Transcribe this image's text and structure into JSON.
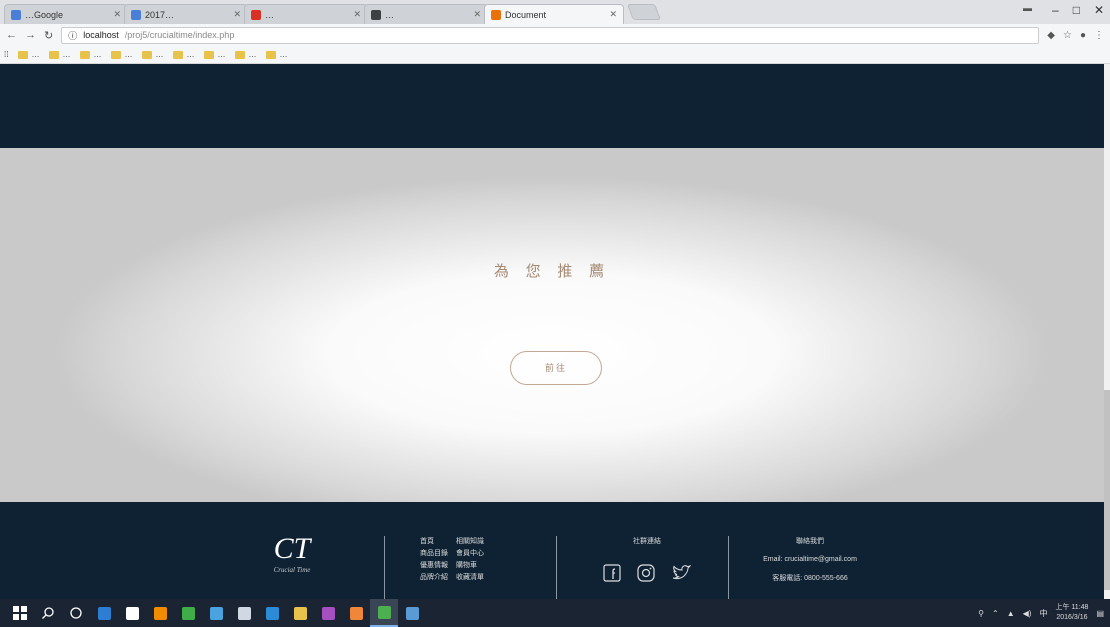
{
  "browser": {
    "tabs": [
      {
        "label": "…Google",
        "color": "#4a7fd8",
        "active": false
      },
      {
        "label": "2017…",
        "color": "#4a7fd8",
        "active": false
      },
      {
        "label": "…",
        "color": "#d93025",
        "active": false
      },
      {
        "label": "…",
        "color": "#3c4043",
        "active": false
      },
      {
        "label": "Document",
        "color": "#e8710a",
        "active": true
      }
    ],
    "address": {
      "host": "localhost",
      "path": "/proj5/crucialtime/index.php"
    },
    "bookmarks": [
      "…",
      "…",
      "…",
      "…",
      "…",
      "…",
      "…",
      "…",
      "…"
    ]
  },
  "page": {
    "recommend": {
      "title": "為 您 推 薦",
      "button": "前往"
    },
    "footer": {
      "logo_mark": "CT",
      "logo_sub": "Crucial Time",
      "links": [
        "首頁",
        "相關知識",
        "商品目錄",
        "會員中心",
        "優惠情報",
        "購物車",
        "品牌介紹",
        "收藏清單"
      ],
      "social_title": "社群連結",
      "contact_title": "聯絡我們",
      "email": "Email: crucialtime@gmail.com",
      "phone": "客服電話: 0800-555-666"
    }
  },
  "taskbar": {
    "apps": [
      {
        "name": "edge",
        "color": "#2d7dd2"
      },
      {
        "name": "store",
        "color": "#ffffff"
      },
      {
        "name": "vlc",
        "color": "#f18b00"
      },
      {
        "name": "app-green",
        "color": "#3fae49"
      },
      {
        "name": "app-blue",
        "color": "#4aa3df"
      },
      {
        "name": "mail",
        "color": "#cfd8e3"
      },
      {
        "name": "vscode",
        "color": "#2b8bd6"
      },
      {
        "name": "explorer",
        "color": "#e8c34b"
      },
      {
        "name": "app-purple",
        "color": "#a54fc1"
      },
      {
        "name": "app-orange",
        "color": "#f0863a"
      },
      {
        "name": "chrome",
        "color": "#4caf50"
      },
      {
        "name": "app-window",
        "color": "#5b9bd5"
      }
    ],
    "time": "上午 11:48",
    "date": "2016/3/16"
  }
}
